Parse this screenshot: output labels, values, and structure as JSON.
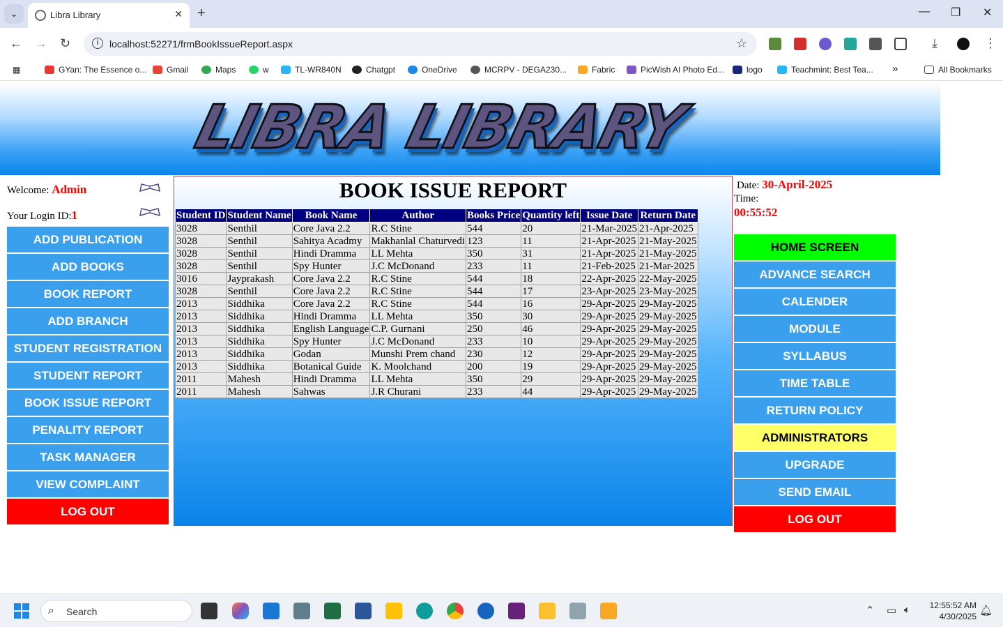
{
  "browser": {
    "tab_title": "Libra Library",
    "url": "localhost:52271/frmBookIssueReport.aspx",
    "bookmarks": [
      "GYan: The Essence o...",
      "Gmail",
      "Maps",
      "w",
      "TL-WR840N",
      "Chatgpt",
      "OneDrive",
      "MCRPV - DEGA230...",
      "Fabric",
      "PicWish AI Photo Ed...",
      "logo",
      "Teachmint: Best Tea...",
      "All Bookmarks"
    ],
    "overflow": "»"
  },
  "banner": {
    "logo_text": "LIBRA LIBRARY"
  },
  "left": {
    "welcome_label": "Welcome:",
    "welcome_user": "Admin",
    "login_label": "Your Login ID:",
    "login_id": "1",
    "menu": [
      "ADD PUBLICATION",
      "ADD BOOKS",
      "BOOK REPORT",
      "ADD BRANCH",
      "STUDENT REGISTRATION",
      "STUDENT REPORT",
      "BOOK ISSUE REPORT",
      "PENALITY REPORT",
      "TASK MANAGER",
      "VIEW COMPLAINT",
      "LOG OUT"
    ]
  },
  "report": {
    "title": "BOOK ISSUE REPORT",
    "columns": [
      "Student ID",
      "Student Name",
      "Book Name",
      "Author",
      "Books Price",
      "Quantity left",
      "Issue Date",
      "Return Date"
    ],
    "rows": [
      [
        "3028",
        "Senthil",
        "Core Java 2.2",
        "R.C Stine",
        "544",
        "20",
        "21-Mar-2025",
        "21-Apr-2025"
      ],
      [
        "3028",
        "Senthil",
        "Sahitya Acadmy",
        "Makhanlal Chaturvedi",
        "123",
        "11",
        "21-Apr-2025",
        "21-May-2025"
      ],
      [
        "3028",
        "Senthil",
        "Hindi Dramma",
        "LL Mehta",
        "350",
        "31",
        "21-Apr-2025",
        "21-May-2025"
      ],
      [
        "3028",
        "Senthil",
        "Spy Hunter",
        "J.C McDonand",
        "233",
        "11",
        "21-Feb-2025",
        "21-Mar-2025"
      ],
      [
        "3016",
        "Jayprakash",
        "Core Java 2.2",
        "R.C Stine",
        "544",
        "18",
        "22-Apr-2025",
        "22-May-2025"
      ],
      [
        "3028",
        "Senthil",
        "Core Java 2.2",
        "R.C Stine",
        "544",
        "17",
        "23-Apr-2025",
        "23-May-2025"
      ],
      [
        "2013",
        "Siddhika",
        "Core Java 2.2",
        "R.C Stine",
        "544",
        "16",
        "29-Apr-2025",
        "29-May-2025"
      ],
      [
        "2013",
        "Siddhika",
        "Hindi Dramma",
        "LL Mehta",
        "350",
        "30",
        "29-Apr-2025",
        "29-May-2025"
      ],
      [
        "2013",
        "Siddhika",
        "English Language",
        "C.P. Gurnani",
        "250",
        "46",
        "29-Apr-2025",
        "29-May-2025"
      ],
      [
        "2013",
        "Siddhika",
        "Spy Hunter",
        "J.C McDonand",
        "233",
        "10",
        "29-Apr-2025",
        "29-May-2025"
      ],
      [
        "2013",
        "Siddhika",
        "Godan",
        "Munshi Prem chand",
        "230",
        "12",
        "29-Apr-2025",
        "29-May-2025"
      ],
      [
        "2013",
        "Siddhika",
        "Botanical Guide",
        "K. Moolchand",
        "200",
        "19",
        "29-Apr-2025",
        "29-May-2025"
      ],
      [
        "2011",
        "Mahesh",
        "Hindi Dramma",
        "LL Mehta",
        "350",
        "29",
        "29-Apr-2025",
        "29-May-2025"
      ],
      [
        "2011",
        "Mahesh",
        "Sahwas",
        "J.R Churani",
        "233",
        "44",
        "29-Apr-2025",
        "29-May-2025"
      ]
    ]
  },
  "right": {
    "date_label": "Date:",
    "date_value": "30-April-2025",
    "time_label": "Time:",
    "time_value": "00:55:52",
    "menu": [
      "HOME SCREEN",
      "ADVANCE SEARCH",
      "CALENDER",
      "MODULE",
      "SYLLABUS",
      "TIME TABLE",
      "RETURN POLICY",
      "ADMINISTRATORS",
      "UPGRADE",
      "SEND EMAIL",
      "LOG OUT"
    ]
  },
  "taskbar": {
    "search_placeholder": "Search",
    "time": "12:55:52 AM",
    "date": "4/30/2025"
  },
  "colors": {
    "nav_blue": "#3aa0ee",
    "logout_red": "#ff0000",
    "home_green": "#00ff00",
    "admin_yellow": "#ffff66",
    "header_navy": "#000080"
  }
}
